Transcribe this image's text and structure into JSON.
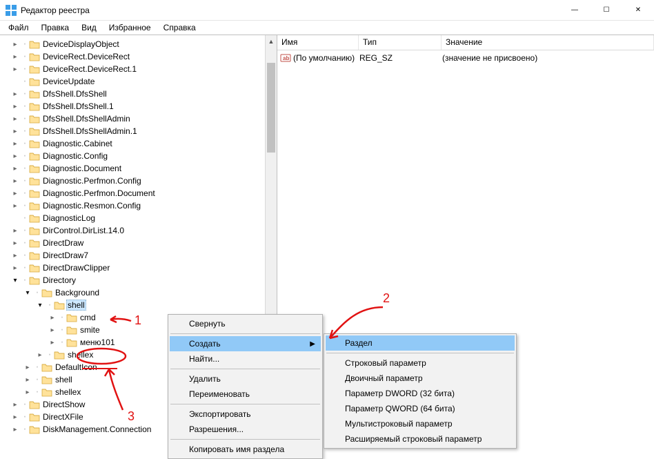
{
  "window": {
    "title": "Редактор реестра",
    "min": "—",
    "max": "☐",
    "close": "✕"
  },
  "menu": {
    "file": "Файл",
    "edit": "Правка",
    "view": "Вид",
    "favorites": "Избранное",
    "help": "Справка"
  },
  "tree": [
    {
      "level": 1,
      "exp": ">",
      "label": "DeviceDisplayObject"
    },
    {
      "level": 1,
      "exp": ">",
      "label": "DeviceRect.DeviceRect"
    },
    {
      "level": 1,
      "exp": ">",
      "label": "DeviceRect.DeviceRect.1"
    },
    {
      "level": 1,
      "exp": "",
      "label": "DeviceUpdate"
    },
    {
      "level": 1,
      "exp": ">",
      "label": "DfsShell.DfsShell"
    },
    {
      "level": 1,
      "exp": ">",
      "label": "DfsShell.DfsShell.1"
    },
    {
      "level": 1,
      "exp": ">",
      "label": "DfsShell.DfsShellAdmin"
    },
    {
      "level": 1,
      "exp": ">",
      "label": "DfsShell.DfsShellAdmin.1"
    },
    {
      "level": 1,
      "exp": ">",
      "label": "Diagnostic.Cabinet"
    },
    {
      "level": 1,
      "exp": ">",
      "label": "Diagnostic.Config"
    },
    {
      "level": 1,
      "exp": ">",
      "label": "Diagnostic.Document"
    },
    {
      "level": 1,
      "exp": ">",
      "label": "Diagnostic.Perfmon.Config"
    },
    {
      "level": 1,
      "exp": ">",
      "label": "Diagnostic.Perfmon.Document"
    },
    {
      "level": 1,
      "exp": ">",
      "label": "Diagnostic.Resmon.Config"
    },
    {
      "level": 1,
      "exp": "",
      "label": "DiagnosticLog"
    },
    {
      "level": 1,
      "exp": ">",
      "label": "DirControl.DirList.14.0"
    },
    {
      "level": 1,
      "exp": ">",
      "label": "DirectDraw"
    },
    {
      "level": 1,
      "exp": ">",
      "label": "DirectDraw7"
    },
    {
      "level": 1,
      "exp": ">",
      "label": "DirectDrawClipper"
    },
    {
      "level": 1,
      "exp": "v",
      "label": "Directory"
    },
    {
      "level": 2,
      "exp": "v",
      "label": "Background"
    },
    {
      "level": 3,
      "exp": "v",
      "label": "shell",
      "selected": true
    },
    {
      "level": 4,
      "exp": ">",
      "label": "cmd"
    },
    {
      "level": 4,
      "exp": ">",
      "label": "smite"
    },
    {
      "level": 4,
      "exp": ">",
      "label": "меню101"
    },
    {
      "level": 3,
      "exp": ">",
      "label": "shellex"
    },
    {
      "level": 2,
      "exp": ">",
      "label": "DefaultIcon"
    },
    {
      "level": 2,
      "exp": ">",
      "label": "shell"
    },
    {
      "level": 2,
      "exp": ">",
      "label": "shellex"
    },
    {
      "level": 1,
      "exp": ">",
      "label": "DirectShow"
    },
    {
      "level": 1,
      "exp": ">",
      "label": "DirectXFile"
    },
    {
      "level": 1,
      "exp": ">",
      "label": "DiskManagement.Connection"
    }
  ],
  "columns": {
    "name": "Имя",
    "type": "Тип",
    "value": "Значение"
  },
  "values": [
    {
      "name": "(По умолчанию)",
      "type": "REG_SZ",
      "value": "(значение не присвоено)"
    }
  ],
  "context_menu": {
    "collapse": "Свернуть",
    "create": "Создать",
    "find": "Найти...",
    "delete": "Удалить",
    "rename": "Переименовать",
    "export": "Экспортировать",
    "permissions": "Разрешения...",
    "copy_key_name": "Копировать имя раздела"
  },
  "submenu": {
    "key": "Раздел",
    "string": "Строковый параметр",
    "binary": "Двоичный параметр",
    "dword": "Параметр DWORD (32 бита)",
    "qword": "Параметр QWORD (64 бита)",
    "multi": "Мультистроковый параметр",
    "expand": "Расширяемый строковый параметр"
  },
  "annotations": {
    "one": "1",
    "two": "2",
    "three": "3"
  }
}
